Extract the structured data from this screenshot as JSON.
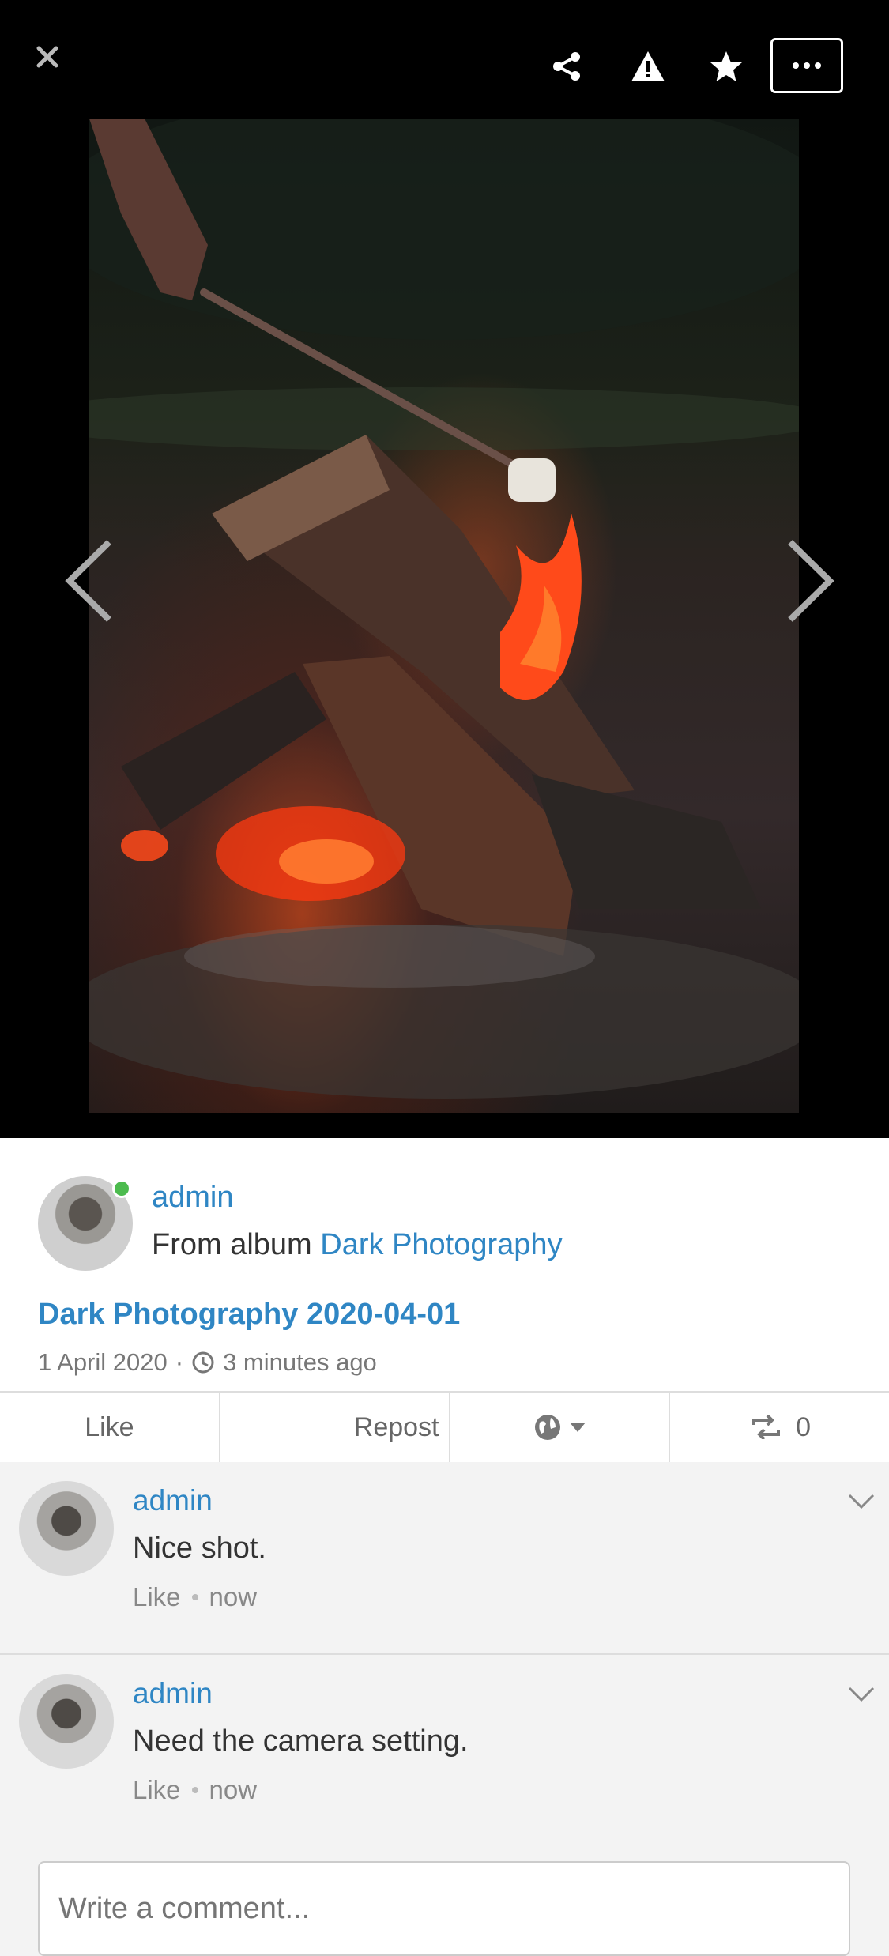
{
  "toolbar": {
    "icons": [
      "close-icon",
      "share-icon",
      "warning-icon",
      "star-icon",
      "more-icon"
    ]
  },
  "photo": {
    "subject": "campfire-photo"
  },
  "details": {
    "author": "admin",
    "album_prefix": "From album",
    "album_name": "Dark Photography",
    "title": "Dark Photography 2020-04-01",
    "date": "1 April 2020",
    "separator": "·",
    "relative_time": "3 minutes ago",
    "online": true
  },
  "actions": {
    "like": "Like",
    "repost": "Repost",
    "repost_count": "0"
  },
  "comments": [
    {
      "author": "admin",
      "text": "Nice shot.",
      "like": "Like",
      "time": "now"
    },
    {
      "author": "admin",
      "text": "Need the camera setting.",
      "like": "Like",
      "time": "now"
    }
  ],
  "composer": {
    "placeholder": "Write a comment..."
  },
  "colors": {
    "link": "#2f86c4",
    "online": "#4cbb4e",
    "background": "#f3f3f3"
  }
}
